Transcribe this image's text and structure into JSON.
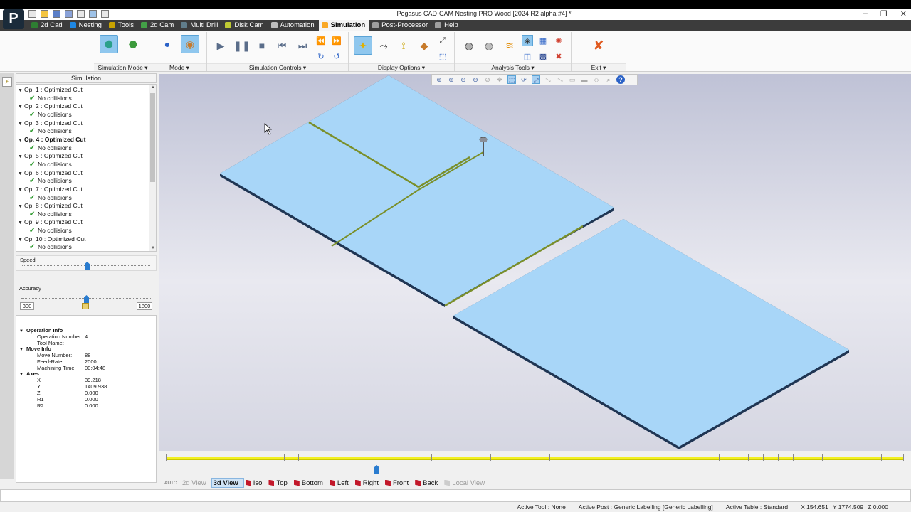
{
  "window": {
    "title": "Pegasus CAD-CAM Nesting PRO Wood [2024 R2 alpha #4] *",
    "logo": "P",
    "controls": [
      "–",
      "❐",
      "✕"
    ]
  },
  "menu": [
    {
      "label": "2d Cad",
      "color": "#2e7d32"
    },
    {
      "label": "Nesting",
      "color": "#1e88e5"
    },
    {
      "label": "Tools",
      "color": "#c8a200"
    },
    {
      "label": "2d Cam",
      "color": "#43a047"
    },
    {
      "label": "Multi Drill",
      "color": "#607d8b"
    },
    {
      "label": "Disk Cam",
      "color": "#c0ca33"
    },
    {
      "label": "Automation",
      "color": "#bdbdbd"
    },
    {
      "label": "Simulation",
      "color": "#f9a825",
      "active": true
    },
    {
      "label": "Post-Processor",
      "color": "#9e9e9e"
    },
    {
      "label": "Help",
      "color": "#9e9e9e"
    }
  ],
  "ribbon": {
    "groups": [
      {
        "label": "Simulation Mode"
      },
      {
        "label": "Mode"
      },
      {
        "label": "Simulation Controls"
      },
      {
        "label": "Display Options"
      },
      {
        "label": "Analysis Tools"
      },
      {
        "label": "Exit"
      }
    ]
  },
  "panel": {
    "title": "Simulation",
    "operations": [
      {
        "label": "Op. 1 : Optimized Cut",
        "status": "No collisions",
        "bold": false
      },
      {
        "label": "Op. 2 : Optimized Cut",
        "status": "No collisions",
        "bold": false
      },
      {
        "label": "Op. 3 : Optimized Cut",
        "status": "No collisions",
        "bold": false
      },
      {
        "label": "Op. 4 : Optimized Cut",
        "status": "No collisions",
        "bold": true
      },
      {
        "label": "Op. 5 : Optimized Cut",
        "status": "No collisions",
        "bold": false
      },
      {
        "label": "Op. 6 : Optimized Cut",
        "status": "No collisions",
        "bold": false
      },
      {
        "label": "Op. 7 : Optimized Cut",
        "status": "No collisions",
        "bold": false
      },
      {
        "label": "Op. 8 : Optimized Cut",
        "status": "No collisions",
        "bold": false
      },
      {
        "label": "Op. 9 : Optimized Cut",
        "status": "No collisions",
        "bold": false
      },
      {
        "label": "Op. 10 : Optimized Cut",
        "status": "No collisions",
        "bold": false
      }
    ],
    "speed": {
      "label": "Speed",
      "value": 0.5
    },
    "accuracy": {
      "label": "Accuracy",
      "value": 0.5,
      "min": "300",
      "max": "1800"
    },
    "info": {
      "operation_info": {
        "title": "Operation Info",
        "rows": [
          {
            "key": "Operation Number:",
            "value": "4"
          },
          {
            "key": "Tool Name:",
            "value": ""
          }
        ]
      },
      "move_info": {
        "title": "Move Info",
        "rows": [
          {
            "key": "Move Number:",
            "value": "88"
          },
          {
            "key": "Feed-Rate:",
            "value": "2000"
          },
          {
            "key": "Machining Time:",
            "value": "00:04:48"
          }
        ]
      },
      "axes": {
        "title": "Axes",
        "rows": [
          {
            "key": "X",
            "value": "39.218"
          },
          {
            "key": "Y",
            "value": "1409.938"
          },
          {
            "key": "Z",
            "value": "0.000"
          },
          {
            "key": "R1",
            "value": "0.000"
          },
          {
            "key": "R2",
            "value": "0.000"
          }
        ]
      }
    }
  },
  "timeline": {
    "position": 0.286
  },
  "view_tabs": [
    {
      "label": "AUTO",
      "kind": "auto"
    },
    {
      "label": "2d View",
      "kind": "disabled"
    },
    {
      "label": "3d View",
      "kind": "selected"
    },
    {
      "label": "Iso",
      "kind": "normal"
    },
    {
      "label": "Top",
      "kind": "normal"
    },
    {
      "label": "Bottom",
      "kind": "normal"
    },
    {
      "label": "Left",
      "kind": "normal"
    },
    {
      "label": "Right",
      "kind": "normal"
    },
    {
      "label": "Front",
      "kind": "normal"
    },
    {
      "label": "Back",
      "kind": "normal"
    },
    {
      "label": "Local View",
      "kind": "disabled"
    }
  ],
  "status": {
    "active_tool": "Active Tool : None",
    "active_post": "Active Post : Generic Labelling [Generic Labelling]",
    "active_table": "Active Table : Standard",
    "x": "X 154.651",
    "y": "Y 1774.509",
    "z": "Z 0.000"
  },
  "colors": {
    "sheet_fill": "#a8d6f8",
    "sheet_edge": "#1f3553",
    "cut_line": "#7a8f2a",
    "timeline": "#f2f020",
    "accent": "#2a7ccf"
  }
}
